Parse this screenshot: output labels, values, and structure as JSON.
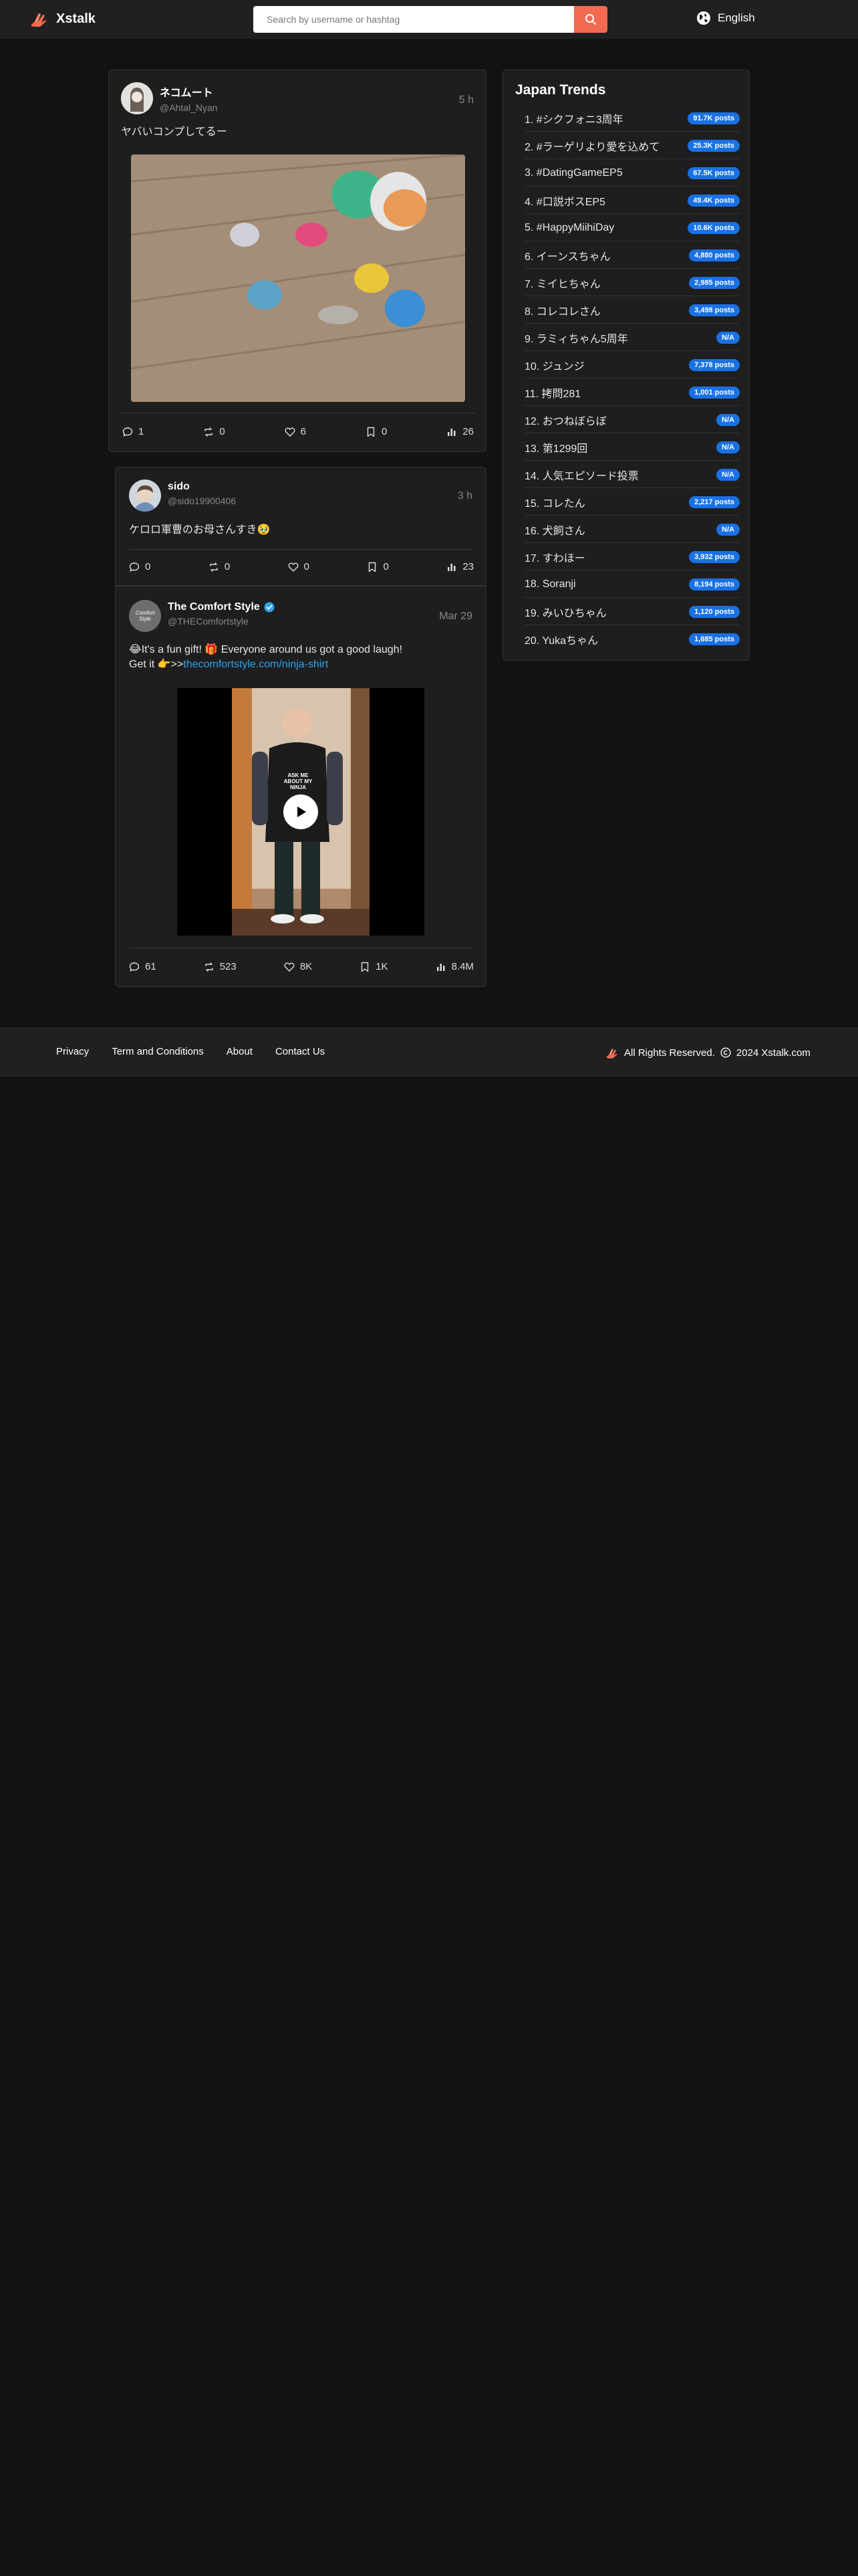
{
  "header": {
    "app_name": "Xstalk",
    "search_placeholder": "Search by username or hashtag",
    "language": "English"
  },
  "posts": [
    {
      "name": "ネコムート",
      "handle": "@Ahtal_Nyan",
      "time": "5 h",
      "text": "ヤバいコンプしてるー",
      "stats": {
        "comments": "1",
        "reposts": "0",
        "likes": "6",
        "bookmarks": "0",
        "views": "26"
      }
    },
    {
      "name": "sido",
      "handle": "@sido19900406",
      "time": "3 h",
      "text": "ケロロ軍曹のお母さんすき🥹",
      "stats": {
        "comments": "0",
        "reposts": "0",
        "likes": "0",
        "bookmarks": "0",
        "views": "23"
      }
    },
    {
      "name": "The Comfort Style",
      "handle": "@THEComfortstyle",
      "time": "Mar 29",
      "text_line1": "😂It's a fun gift! 🎁 Everyone around us got a good laugh!",
      "text_line2_prefix": "Get it 👉>>",
      "link": "thecomfortstyle.com/ninja-shirt",
      "video_shirt_text": "ASK ME ABOUT MY NINJA",
      "avatar_text": "Comfort Style",
      "stats": {
        "comments": "61",
        "reposts": "523",
        "likes": "8K",
        "bookmarks": "1K",
        "views": "8.4M"
      }
    }
  ],
  "trends": {
    "title": "Japan Trends",
    "items": [
      {
        "label": "1. #シクフォニ3周年",
        "count": "91.7K posts"
      },
      {
        "label": "2. #ラーゲリより愛を込めて",
        "count": "25.3K posts"
      },
      {
        "label": "3. #DatingGameEP5",
        "count": "67.5K posts"
      },
      {
        "label": "4. #口説ボスEP5",
        "count": "49.4K posts"
      },
      {
        "label": "5. #HappyMiihiDay",
        "count": "10.6K posts"
      },
      {
        "label": "6. イーンスちゃん",
        "count": "4,880 posts"
      },
      {
        "label": "7. ミイヒちゃん",
        "count": "2,985 posts"
      },
      {
        "label": "8. コレコレさん",
        "count": "3,498 posts"
      },
      {
        "label": "9. ラミィちゃん5周年",
        "count": "N/A"
      },
      {
        "label": "10. ジュンジ",
        "count": "7,378 posts"
      },
      {
        "label": "11. 拷問281",
        "count": "1,001 posts"
      },
      {
        "label": "12. おつねぼらぼ",
        "count": "N/A"
      },
      {
        "label": "13. 第1299回",
        "count": "N/A"
      },
      {
        "label": "14. 人気エピソード投票",
        "count": "N/A"
      },
      {
        "label": "15. コレたん",
        "count": "2,217 posts"
      },
      {
        "label": "16. 犬飼さん",
        "count": "N/A"
      },
      {
        "label": "17. すわほー",
        "count": "3,932 posts"
      },
      {
        "label": "18. Soranji",
        "count": "8,194 posts"
      },
      {
        "label": "19. みいひちゃん",
        "count": "1,120 posts"
      },
      {
        "label": "20. Yukaちゃん",
        "count": "1,685 posts"
      }
    ]
  },
  "footer": {
    "links": [
      "Privacy",
      "Term and Conditions",
      "About",
      "Contact Us"
    ],
    "rights": "All Rights Reserved.",
    "copyright": "2024 Xstalk.com"
  },
  "colors": {
    "background": "#121212",
    "header": "#202020",
    "card": "#1e1e1e",
    "accent": "#f26a51",
    "badge": "#1971e6",
    "link": "#2fa3ee"
  }
}
